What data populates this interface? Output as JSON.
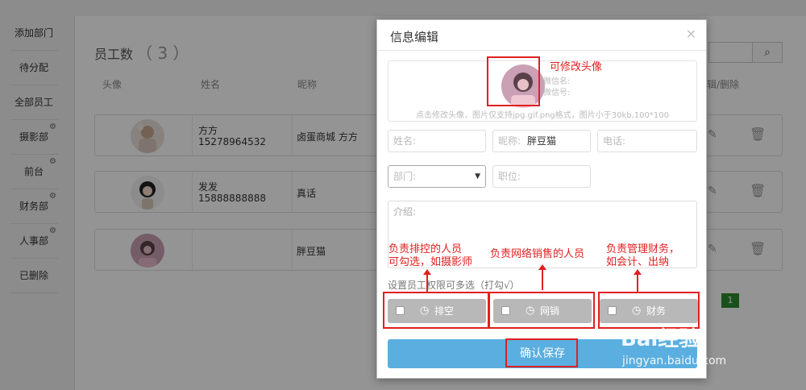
{
  "sidebar": {
    "items": [
      {
        "label": "添加部门",
        "gear": false
      },
      {
        "label": "待分配",
        "gear": false
      },
      {
        "label": "全部员工",
        "gear": false
      },
      {
        "label": "摄影部",
        "gear": true
      },
      {
        "label": "前台",
        "gear": true
      },
      {
        "label": "财务部",
        "gear": true
      },
      {
        "label": "人事部",
        "gear": true
      },
      {
        "label": "已删除",
        "gear": false
      }
    ]
  },
  "main": {
    "count_label": "员工数",
    "count_value": "（ 3 ）",
    "columns": [
      "头像",
      "姓名",
      "昵称",
      "编辑/删除"
    ],
    "rows": [
      {
        "name": "方方",
        "phone": "15278964532",
        "nickname": "卤蛋商城 方方"
      },
      {
        "name": "发发",
        "phone": "15888888888",
        "nickname": "真话"
      },
      {
        "name": "",
        "phone": "",
        "nickname": "胖豆猫"
      }
    ],
    "page": "1"
  },
  "modal": {
    "title": "信息编辑",
    "close": "×",
    "wechat_name": "微信名:",
    "wechat_id": "微信号:",
    "photo_hint": "点击修改头像，图片仅支持jpg.gif.png格式，图片小于30kb,100*100",
    "name_placeholder": "姓名:",
    "nickname_label": "昵称:",
    "nickname_value": "胖豆猫",
    "phone_placeholder": "电话:",
    "dept_label": "部门:",
    "position_placeholder": "职位:",
    "intro_placeholder": "介绍:",
    "perm_label": "设置员工权限可多选（打勾√）",
    "perms": [
      "排空",
      "网销",
      "财务"
    ],
    "save_label": "确认保存"
  },
  "annotations": {
    "avatar": "可修改头像",
    "perm1_line1": "负责排控的人员",
    "perm1_line2": "可勾选，如摄影师",
    "perm2": "负责网络销售的人员",
    "perm3_line1": "负责管理财务，",
    "perm3_line2": "如会计、出纳"
  },
  "watermark": {
    "brand": "Bai经验",
    "url": "jingyan.baidu.com"
  },
  "colors": {
    "accent": "#5aaee0",
    "annotation": "#e02020",
    "pager": "#2e8b2e"
  }
}
